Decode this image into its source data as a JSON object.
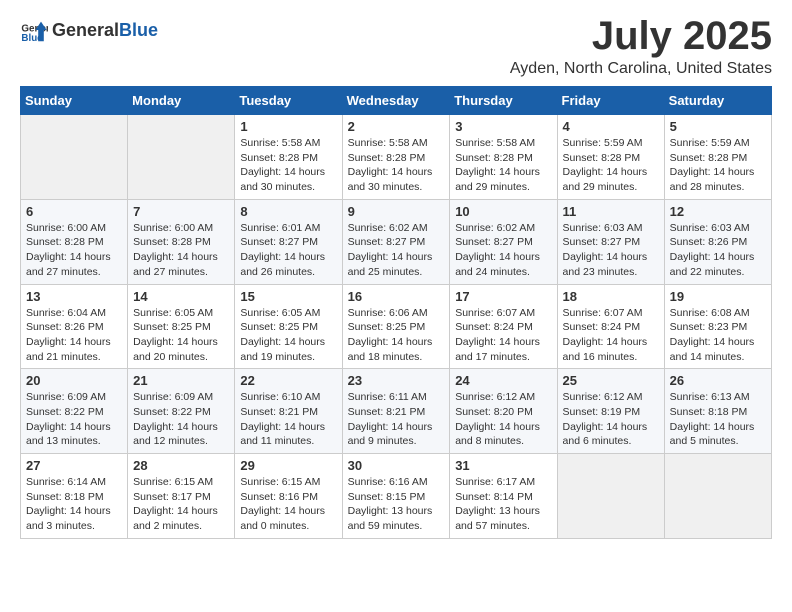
{
  "header": {
    "logo_general": "General",
    "logo_blue": "Blue",
    "month_year": "July 2025",
    "location": "Ayden, North Carolina, United States"
  },
  "calendar": {
    "days_of_week": [
      "Sunday",
      "Monday",
      "Tuesday",
      "Wednesday",
      "Thursday",
      "Friday",
      "Saturday"
    ],
    "weeks": [
      [
        {
          "day": "",
          "empty": true
        },
        {
          "day": "",
          "empty": true
        },
        {
          "day": "1",
          "sunrise": "5:58 AM",
          "sunset": "8:28 PM",
          "daylight": "14 hours and 30 minutes."
        },
        {
          "day": "2",
          "sunrise": "5:58 AM",
          "sunset": "8:28 PM",
          "daylight": "14 hours and 30 minutes."
        },
        {
          "day": "3",
          "sunrise": "5:58 AM",
          "sunset": "8:28 PM",
          "daylight": "14 hours and 29 minutes."
        },
        {
          "day": "4",
          "sunrise": "5:59 AM",
          "sunset": "8:28 PM",
          "daylight": "14 hours and 29 minutes."
        },
        {
          "day": "5",
          "sunrise": "5:59 AM",
          "sunset": "8:28 PM",
          "daylight": "14 hours and 28 minutes."
        }
      ],
      [
        {
          "day": "6",
          "sunrise": "6:00 AM",
          "sunset": "8:28 PM",
          "daylight": "14 hours and 27 minutes."
        },
        {
          "day": "7",
          "sunrise": "6:00 AM",
          "sunset": "8:28 PM",
          "daylight": "14 hours and 27 minutes."
        },
        {
          "day": "8",
          "sunrise": "6:01 AM",
          "sunset": "8:27 PM",
          "daylight": "14 hours and 26 minutes."
        },
        {
          "day": "9",
          "sunrise": "6:02 AM",
          "sunset": "8:27 PM",
          "daylight": "14 hours and 25 minutes."
        },
        {
          "day": "10",
          "sunrise": "6:02 AM",
          "sunset": "8:27 PM",
          "daylight": "14 hours and 24 minutes."
        },
        {
          "day": "11",
          "sunrise": "6:03 AM",
          "sunset": "8:27 PM",
          "daylight": "14 hours and 23 minutes."
        },
        {
          "day": "12",
          "sunrise": "6:03 AM",
          "sunset": "8:26 PM",
          "daylight": "14 hours and 22 minutes."
        }
      ],
      [
        {
          "day": "13",
          "sunrise": "6:04 AM",
          "sunset": "8:26 PM",
          "daylight": "14 hours and 21 minutes."
        },
        {
          "day": "14",
          "sunrise": "6:05 AM",
          "sunset": "8:25 PM",
          "daylight": "14 hours and 20 minutes."
        },
        {
          "day": "15",
          "sunrise": "6:05 AM",
          "sunset": "8:25 PM",
          "daylight": "14 hours and 19 minutes."
        },
        {
          "day": "16",
          "sunrise": "6:06 AM",
          "sunset": "8:25 PM",
          "daylight": "14 hours and 18 minutes."
        },
        {
          "day": "17",
          "sunrise": "6:07 AM",
          "sunset": "8:24 PM",
          "daylight": "14 hours and 17 minutes."
        },
        {
          "day": "18",
          "sunrise": "6:07 AM",
          "sunset": "8:24 PM",
          "daylight": "14 hours and 16 minutes."
        },
        {
          "day": "19",
          "sunrise": "6:08 AM",
          "sunset": "8:23 PM",
          "daylight": "14 hours and 14 minutes."
        }
      ],
      [
        {
          "day": "20",
          "sunrise": "6:09 AM",
          "sunset": "8:22 PM",
          "daylight": "14 hours and 13 minutes."
        },
        {
          "day": "21",
          "sunrise": "6:09 AM",
          "sunset": "8:22 PM",
          "daylight": "14 hours and 12 minutes."
        },
        {
          "day": "22",
          "sunrise": "6:10 AM",
          "sunset": "8:21 PM",
          "daylight": "14 hours and 11 minutes."
        },
        {
          "day": "23",
          "sunrise": "6:11 AM",
          "sunset": "8:21 PM",
          "daylight": "14 hours and 9 minutes."
        },
        {
          "day": "24",
          "sunrise": "6:12 AM",
          "sunset": "8:20 PM",
          "daylight": "14 hours and 8 minutes."
        },
        {
          "day": "25",
          "sunrise": "6:12 AM",
          "sunset": "8:19 PM",
          "daylight": "14 hours and 6 minutes."
        },
        {
          "day": "26",
          "sunrise": "6:13 AM",
          "sunset": "8:18 PM",
          "daylight": "14 hours and 5 minutes."
        }
      ],
      [
        {
          "day": "27",
          "sunrise": "6:14 AM",
          "sunset": "8:18 PM",
          "daylight": "14 hours and 3 minutes."
        },
        {
          "day": "28",
          "sunrise": "6:15 AM",
          "sunset": "8:17 PM",
          "daylight": "14 hours and 2 minutes."
        },
        {
          "day": "29",
          "sunrise": "6:15 AM",
          "sunset": "8:16 PM",
          "daylight": "14 hours and 0 minutes."
        },
        {
          "day": "30",
          "sunrise": "6:16 AM",
          "sunset": "8:15 PM",
          "daylight": "13 hours and 59 minutes."
        },
        {
          "day": "31",
          "sunrise": "6:17 AM",
          "sunset": "8:14 PM",
          "daylight": "13 hours and 57 minutes."
        },
        {
          "day": "",
          "empty": true
        },
        {
          "day": "",
          "empty": true
        }
      ]
    ]
  }
}
